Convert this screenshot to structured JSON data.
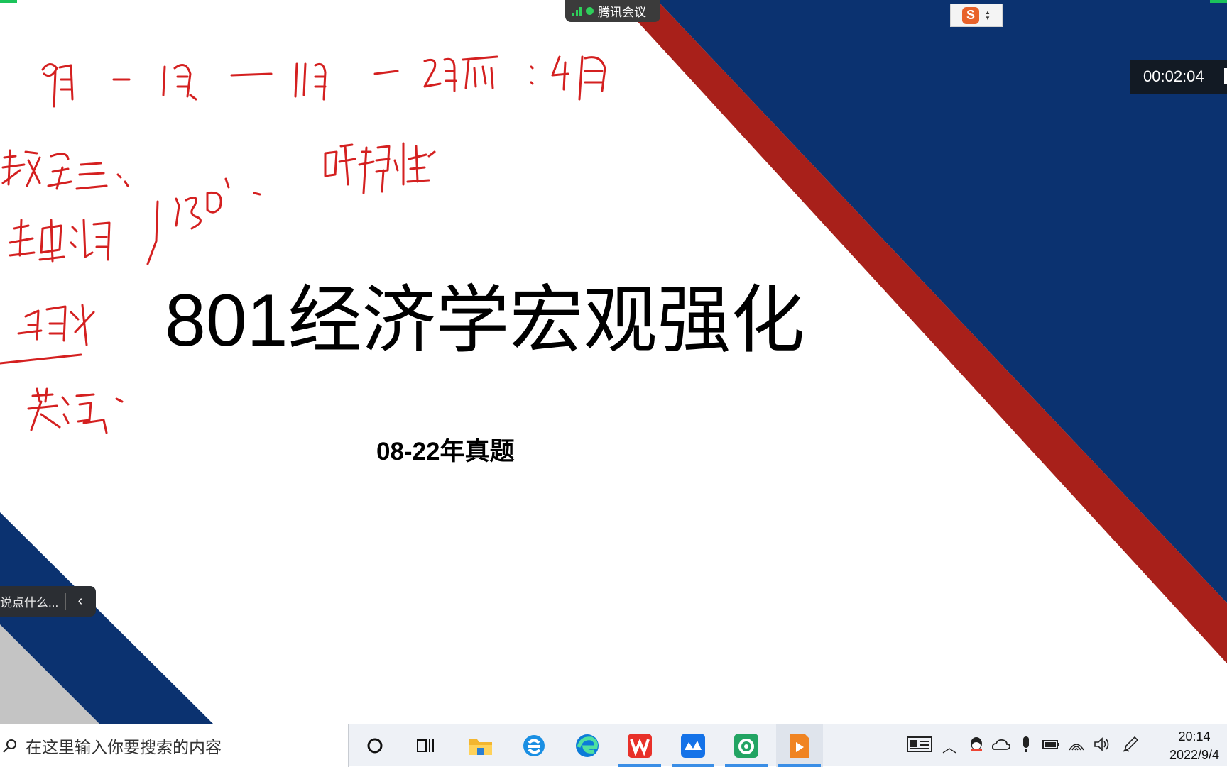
{
  "slide": {
    "title": "801经济学宏观强化",
    "subtitle": "08-22年真题",
    "colors": {
      "navy": "#0b3270",
      "red": "#a8201a",
      "gray": "#c4c4c4"
    }
  },
  "meeting": {
    "app_name": "腾讯会议",
    "signal_color": "#2fcf5b"
  },
  "ime": {
    "logo": "S"
  },
  "timer": {
    "elapsed": "00:02:04"
  },
  "chat": {
    "placeholder": "说点什么...",
    "collapse_icon": "chevron-left-icon"
  },
  "taskbar": {
    "search_placeholder": "在这里输入你要搜索的内容",
    "apps": [
      "cortana-icon",
      "task-view-icon",
      "file-explorer-icon",
      "ie-browser-icon",
      "edge-browser-icon",
      "wps-office-icon",
      "tencent-meeting-icon",
      "screen-recorder-icon",
      "media-player-icon"
    ],
    "tray_icons": [
      "news-widget-icon",
      "chevron-up-icon",
      "qq-icon",
      "onedrive-icon",
      "microphone-icon",
      "battery-icon",
      "wifi-icon",
      "volume-icon",
      "pen-icon"
    ],
    "clock": {
      "time": "20:14",
      "date": "2022/9/4"
    }
  }
}
